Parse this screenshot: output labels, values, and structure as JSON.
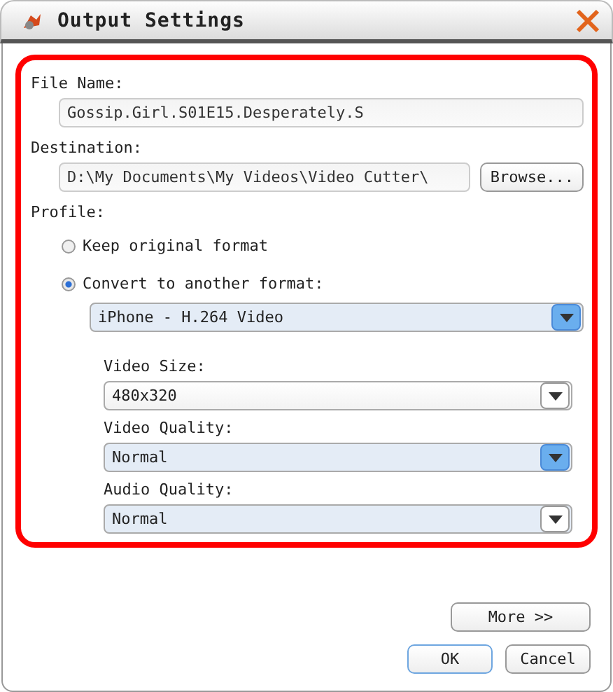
{
  "window": {
    "title": "Output Settings"
  },
  "file_name": {
    "label": "File Name:",
    "value": "Gossip.Girl.S01E15.Desperately.S"
  },
  "destination": {
    "label": "Destination:",
    "value": "D:\\My Documents\\My Videos\\Video Cutter\\",
    "button": "Browse..."
  },
  "profile": {
    "label": "Profile:",
    "options": [
      {
        "label": "Keep original format",
        "selected": false
      },
      {
        "label": "Convert to another format:",
        "selected": true
      }
    ],
    "format": {
      "value": "iPhone - H.264 Video",
      "highlighted": true,
      "arrow_active": true
    }
  },
  "settings": [
    {
      "label": "Video Size:",
      "value": "480x320",
      "highlighted": false,
      "arrow_active": false
    },
    {
      "label": "Video Quality:",
      "value": "Normal",
      "highlighted": true,
      "arrow_active": true
    },
    {
      "label": "Audio Quality:",
      "value": "Normal",
      "highlighted": true,
      "arrow_active": false
    }
  ],
  "buttons": {
    "more": "More >>",
    "ok": "OK",
    "cancel": "Cancel"
  }
}
